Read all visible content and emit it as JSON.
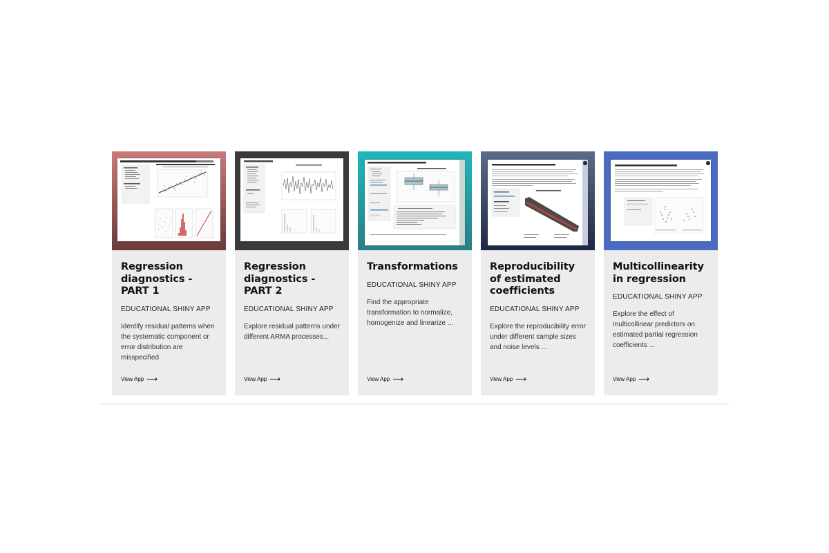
{
  "cards": [
    {
      "title": "Regression diagnostics - PART 1",
      "tag": "EDUCATIONAL SHINY APP",
      "description": "Identify residual patterns when the systematic component or error distribution are misspecified",
      "link": "View App",
      "thumb_colors": [
        "#c97a7a",
        "#6b3a3a"
      ],
      "thumb_heading": "Checking for normality, homogeneity and linearity assumptions"
    },
    {
      "title": "Regression diagnostics - PART 2",
      "tag": "EDUCATIONAL SHINY APP",
      "description": "Explore residual patterns under different ARMA processes...",
      "link": "View App",
      "thumb_colors": [
        "#3a3a3a",
        "#3a3a3a"
      ],
      "thumb_heading": "Patterns of autocorrelation"
    },
    {
      "title": "Transformations",
      "tag": "EDUCATIONAL SHINY APP",
      "description": "Find the appropriate transformation to normalize, homogenize and linearize ...",
      "link": "View App",
      "thumb_colors": [
        "#1fb7b9",
        "#2a7f86"
      ],
      "thumb_heading": "Transformations to reduce differences in variance"
    },
    {
      "title": "Reproducibility of estimated coefficients",
      "tag": "EDUCATIONAL SHINY APP",
      "description": "Explore the reproducibility error under different sample sizes and noise levels ...",
      "link": "View App",
      "thumb_colors": [
        "#5c6c88",
        "#1d2846"
      ],
      "thumb_heading": "Reproducibility of estimated coefficients"
    },
    {
      "title": "Multicollinearity in regression",
      "tag": "EDUCATIONAL SHINY APP",
      "description": "Explore the effect of multicollinear predictors on estimated partial regression coefficients ...",
      "link": "View App",
      "thumb_colors": [
        "#4a6bc0",
        "#4a6bc0"
      ],
      "thumb_heading": "Multicollinearity in multiple regression"
    }
  ],
  "icons": {
    "link_arrow": "arrow-right-icon"
  }
}
